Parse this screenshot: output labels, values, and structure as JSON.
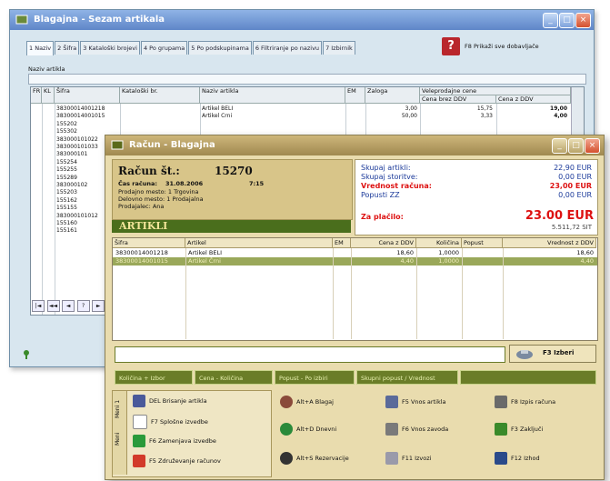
{
  "win1": {
    "title": "Blagajna - Sezam artikala",
    "tabs": [
      "1 Naziv",
      "2 Šifra",
      "3 Kataloški brojevi",
      "4 Po grupama",
      "5 Po podskupinama",
      "6 Filtriranje po nazivu",
      "7 Izbirnik"
    ],
    "ext_button": "F8 Prikaži sve dobavljače",
    "filter_label": "Naziv artikla",
    "columns": [
      "FR",
      "KL",
      "Šifra",
      "Kataloški br.",
      "Naziv artikla",
      "EM",
      "Zaloga"
    ],
    "price_group": "Veleprodajne cene",
    "price_cols": [
      "Cena brez DDV",
      "Cena z DDV"
    ],
    "rows": [
      {
        "sifra": "38300014001218",
        "naziv": "Artikel BELI",
        "zaloga": "3,00",
        "cena_brez": "15,75",
        "cena_z": "19,00"
      },
      {
        "sifra": "38300014001015",
        "naziv": "Artikel Črni",
        "zaloga": "50,00",
        "cena_brez": "3,33",
        "cena_z": "4,00"
      },
      {
        "sifra": "155202"
      },
      {
        "sifra": "155302"
      },
      {
        "sifra": "383000101022"
      },
      {
        "sifra": "383000101033"
      },
      {
        "sifra": "383000101"
      },
      {
        "sifra": "155254"
      },
      {
        "sifra": "155255"
      },
      {
        "sifra": "155289"
      },
      {
        "sifra": "383000102"
      },
      {
        "sifra": "155203"
      },
      {
        "sifra": "155162"
      },
      {
        "sifra": "155155"
      },
      {
        "sifra": "383000101012"
      },
      {
        "sifra": "155160"
      },
      {
        "sifra": "155161"
      }
    ],
    "nav": [
      "|◄",
      "◄◄",
      "◄",
      "?",
      "►"
    ]
  },
  "win2": {
    "title": "Račun - Blagajna",
    "invoice_label": "Račun št.:",
    "invoice_no": "15270",
    "time_label": "Čas računa:",
    "time_value": "31.08.2006",
    "time_extra": "7:15",
    "line2": "Prodajno mesto: 1 Trgovina",
    "line3": "Delovno mesto: 1 Prodajalna",
    "line4": "Prodajalec: Ana",
    "summary": [
      {
        "label": "Skupaj artikli:",
        "value": "22,90 EUR"
      },
      {
        "label": "Skupaj storitve:",
        "value": "0,00 EUR"
      },
      {
        "label": "Vrednost računa:",
        "value": "23,00 EUR"
      },
      {
        "label": "Popusti ZZ",
        "value": "0,00 EUR"
      }
    ],
    "to_pay_label": "Za plačilo:",
    "to_pay_value": "23.00 EUR",
    "to_pay_sub": "5.511,72 SIT",
    "articles_label": "ARTIKLI",
    "columns": [
      "Šifra",
      "Artikel",
      "EM",
      "Cena z DDV",
      "Količina",
      "Popust",
      "Vrednost z DDV"
    ],
    "rows": [
      {
        "sifra": "38300014001218",
        "artikel": "Artikel BELI",
        "cena": "18,60",
        "kolicina": "1,0000",
        "vrednost": "18,60"
      },
      {
        "sifra": "38300014001015",
        "artikel": "Artikel Črni",
        "cena": "4,40",
        "kolicina": "1,0000",
        "vrednost": "4,40"
      }
    ],
    "input_value": "",
    "save_label": "F3 Izberi",
    "strip_buttons": [
      "Količina + Izbor",
      "Cena - Količina",
      "Popust - Po izbiri",
      "Skupni popust / Vrednost"
    ],
    "side_tabs": [
      "Meni",
      "Meni 1"
    ],
    "menu": [
      "DEL Brisanje artikla",
      "F7 Splošne izvedbe",
      "F6 Zamenjava izvedbe",
      "F5 Združevanje računov"
    ],
    "fkeys": [
      "Alt+A Blagaj",
      "Alt+D Dnevni",
      "Alt+S Rezervacije",
      "F5 Vnos artikla",
      "F6 Vnos zavoda",
      "F11 Izvozi",
      "F8 Izpis računa",
      "F3 Zaključi",
      "F12 Izhod"
    ]
  },
  "colors": {
    "front_bg": "#e9dcae",
    "green": "#4a6e1c",
    "back_bg": "#d8e6ef",
    "accent_red": "#d11111"
  }
}
